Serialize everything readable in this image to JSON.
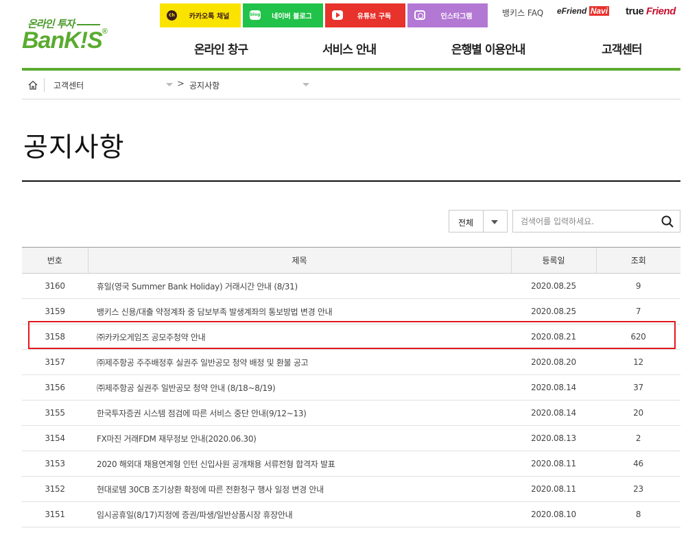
{
  "logo": {
    "tagline": "온라인 투자",
    "name": "BanK!S",
    "reg": "®"
  },
  "sns": [
    {
      "label": "카카오톡 채널",
      "icon": "kakao-ch-icon",
      "icon_text": "Ch"
    },
    {
      "label": "네이버 블로그",
      "icon": "naver-blog-icon",
      "icon_text": "blog"
    },
    {
      "label": "유튜브 구독",
      "icon": "youtube-icon"
    },
    {
      "label": "인스타그램",
      "icon": "instagram-icon"
    }
  ],
  "top_links": {
    "faq": "뱅키스 FAQ",
    "efriend_prefix": "eFriend",
    "efriend_suffix": "Navi",
    "truefriend_prefix": "true",
    "truefriend_suffix": "Friend"
  },
  "gnb": [
    "온라인 창구",
    "서비스 안내",
    "은행별 이용안내",
    "고객센터"
  ],
  "breadcrumb": {
    "level1": "고객센터",
    "level2": "공지사항"
  },
  "page_title": "공지사항",
  "search": {
    "select_value": "전체",
    "placeholder": "검색어를 입력하세요."
  },
  "table": {
    "headers": [
      "번호",
      "제목",
      "등록일",
      "조회"
    ],
    "rows": [
      {
        "no": "3160",
        "title": "휴일(영국 Summer Bank Holiday) 거래시간 안내 (8/31)",
        "date": "2020.08.25",
        "views": "9"
      },
      {
        "no": "3159",
        "title": "뱅키스 신용/대출 약정계좌 중 담보부족 발생계좌의 통보방법 변경 안내",
        "date": "2020.08.25",
        "views": "7"
      },
      {
        "no": "3158",
        "title": "㈜카카오게임즈 공모주청약 안내",
        "date": "2020.08.21",
        "views": "620"
      },
      {
        "no": "3157",
        "title": "㈜제주항공 주주배정후 실권주 일반공모 청약 배정 및 환불 공고",
        "date": "2020.08.20",
        "views": "12"
      },
      {
        "no": "3156",
        "title": "㈜제주항공 실권주 일반공모 청약 안내 (8/18~8/19)",
        "date": "2020.08.14",
        "views": "37"
      },
      {
        "no": "3155",
        "title": "한국투자증권 시스템 점검에 따른 서비스 중단 안내(9/12~13)",
        "date": "2020.08.14",
        "views": "20"
      },
      {
        "no": "3154",
        "title": "FX마진 거래FDM 재무정보 안내(2020.06.30)",
        "date": "2020.08.13",
        "views": "2"
      },
      {
        "no": "3153",
        "title": "2020 해외대 채용연계형 인턴 신입사원 공개채용 서류전형 합격자 발표",
        "date": "2020.08.11",
        "views": "46"
      },
      {
        "no": "3152",
        "title": "현대로템 30CB 조기상환 확정에 따른 전환청구 행사 일정 변경 안내",
        "date": "2020.08.11",
        "views": "23"
      },
      {
        "no": "3151",
        "title": "임시공휴일(8/17)지정에 증권/파생/일반상품시장 휴장안내",
        "date": "2020.08.10",
        "views": "8"
      }
    ]
  },
  "colors": {
    "brand_green": "#5aab2f",
    "kakao": "#fbe300",
    "naver": "#21c249",
    "youtube": "#e8322c",
    "instagram": "#b378d4",
    "highlight": "#e3171c"
  }
}
